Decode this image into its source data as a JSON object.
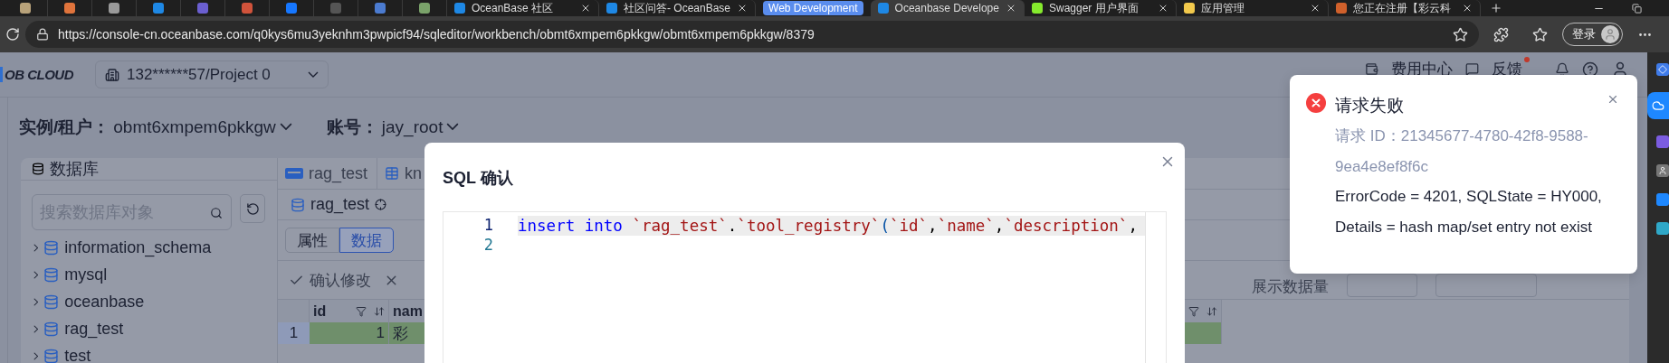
{
  "browser": {
    "tabs": [
      {
        "kind": "icon",
        "color": "#b8a27a",
        "selected": false
      },
      {
        "kind": "icon",
        "color": "#e0743c",
        "selected": false
      },
      {
        "kind": "icon",
        "color": "#9a9a9a",
        "selected": false
      },
      {
        "kind": "icon",
        "color": "#1e88e5",
        "selected": false
      },
      {
        "kind": "icon",
        "color": "#6b5fd0",
        "selected": false
      },
      {
        "kind": "icon",
        "color": "#d0533b",
        "selected": false
      },
      {
        "kind": "icon",
        "color": "#1677ff",
        "selected": false
      },
      {
        "kind": "icon",
        "color": "#555555",
        "selected": false
      },
      {
        "kind": "icon",
        "color": "#4b7bd0",
        "selected": false
      },
      {
        "kind": "icon",
        "color": "#7aa36a",
        "selected": false
      },
      {
        "kind": "page",
        "title": "OceanBase 社区",
        "color": "#1e88e5",
        "selected": false
      },
      {
        "kind": "page",
        "title": "社区问答- OceanBase",
        "color": "#1e88e5",
        "selected": false
      },
      {
        "kind": "group",
        "title": "Web Development"
      },
      {
        "kind": "page",
        "title": "Oceanbase Develope",
        "color": "#1e88e5",
        "selected": true
      },
      {
        "kind": "page",
        "title": "Swagger 用户界面",
        "color": "#85ea2d",
        "selected": false
      },
      {
        "kind": "page",
        "title": "应用管理",
        "color": "#f2c94c",
        "selected": false
      },
      {
        "kind": "page",
        "title": "您正在注册【彩云科",
        "color": "#d0602b",
        "selected": false
      }
    ],
    "url": "https://console-cn.oceanbase.com/q0kys6mu3yeknhm3pwpicf94/sqleditor/workbench/obmt6xmpem6pkkgw/obmt6xmpem6pkkgw/8379",
    "login": "登录"
  },
  "header": {
    "logo": "OB CLOUD",
    "project": "132******57/Project 0",
    "nav": [
      {
        "label": "费用中心",
        "has_dot": false
      },
      {
        "label": "反馈",
        "has_dot": true
      }
    ]
  },
  "context": [
    {
      "label": "实例/租户：",
      "value": "obmt6xmpem6pkkgw"
    },
    {
      "label": "账号：",
      "value": "jay_root"
    }
  ],
  "sidebar": {
    "title": "数据库",
    "search": {
      "placeholder": "搜索数据库对象"
    },
    "items": [
      {
        "label": "information_schema",
        "expanded": false
      },
      {
        "label": "mysql",
        "expanded": false
      },
      {
        "label": "oceanbase",
        "expanded": false
      },
      {
        "label": "rag_test",
        "expanded": false
      },
      {
        "label": "test",
        "expanded": false
      }
    ]
  },
  "editor": {
    "tabs": [
      {
        "kind": "sql",
        "label": "rag_test"
      },
      {
        "kind": "table",
        "label": "kn"
      }
    ],
    "object": "rag_test",
    "segments": [
      {
        "label": "属性",
        "selected": false
      },
      {
        "label": "数据",
        "selected": true
      }
    ],
    "toolbar": {
      "confirm": "确认修改",
      "display_label": "展示数据量"
    },
    "table": {
      "columns": [
        "id",
        "nam"
      ],
      "rows": [
        {
          "number": "1",
          "cells": [
            "1",
            "彩"
          ],
          "modified": true
        }
      ]
    }
  },
  "modal": {
    "title": "SQL 确认",
    "lines": [
      {
        "number": "1",
        "highlighted": true,
        "tokens": [
          {
            "kind": "keyword",
            "text": "insert"
          },
          {
            "kind": "keyword",
            "text": "into"
          },
          {
            "kind": "identifier",
            "text": "`rag_test`"
          },
          {
            "kind": "punct",
            "text": "."
          },
          {
            "kind": "identifier",
            "text": "`tool_registry`"
          },
          {
            "kind": "paren",
            "text": "("
          },
          {
            "kind": "identifier",
            "text": "`id`"
          },
          {
            "kind": "punct",
            "text": ","
          },
          {
            "kind": "identifier",
            "text": "`name`"
          },
          {
            "kind": "punct",
            "text": ","
          },
          {
            "kind": "identifier",
            "text": "`description`"
          },
          {
            "kind": "punct",
            "text": ","
          }
        ]
      },
      {
        "number": "2",
        "highlighted": false
      }
    ]
  },
  "notification": {
    "kind": "error",
    "title": "请求失败",
    "request_id": "请求 ID：21345677-4780-42f8-9588-9ea4e8ef8f6c",
    "message": "ErrorCode = 4201, SQLState = HY000, Details = hash map/set entry not exist"
  }
}
